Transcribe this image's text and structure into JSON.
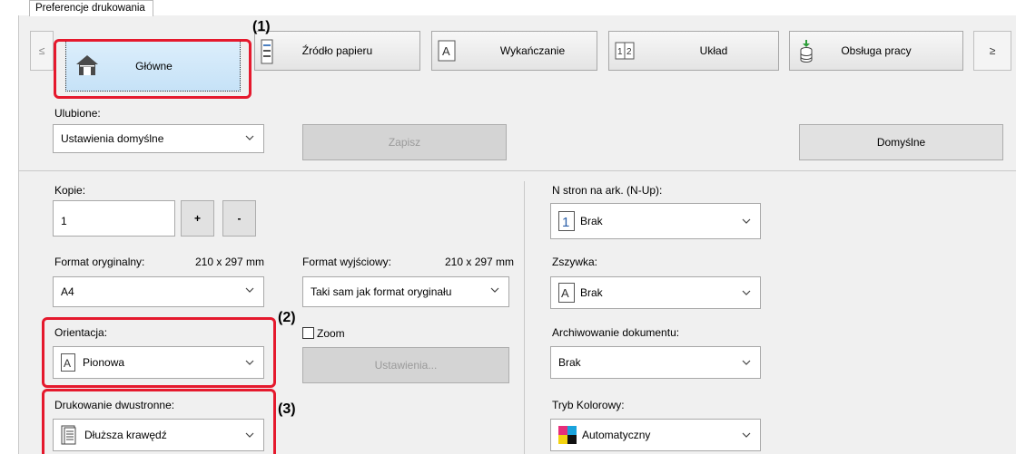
{
  "window": {
    "tab_title": "Preferencje drukowania"
  },
  "toolbar": {
    "prev_arrow": "≤",
    "next_arrow": "≥",
    "tabs": [
      {
        "label": "Główne",
        "icon": "home-icon"
      },
      {
        "label": "Źródło papieru",
        "icon": "paper-tray-icon"
      },
      {
        "label": "Wykańczanie",
        "icon": "finishing-icon"
      },
      {
        "label": "Układ",
        "icon": "layout-icon"
      },
      {
        "label": "Obsługa pracy",
        "icon": "job-handling-icon"
      }
    ]
  },
  "favorites": {
    "label": "Ulubione:",
    "value": "Ustawienia domyślne",
    "save_label": "Zapisz",
    "defaults_label": "Domyślne"
  },
  "copies": {
    "label": "Kopie:",
    "value": "1",
    "plus": "+",
    "minus": "-"
  },
  "original_size": {
    "label": "Format oryginalny:",
    "size": "210 x 297 mm",
    "value": "A4"
  },
  "output_size": {
    "label": "Format wyjściowy:",
    "size": "210 x 297 mm",
    "value": "Taki sam jak format oryginału"
  },
  "orientation": {
    "label": "Orientacja:",
    "value": "Pionowa"
  },
  "zoom": {
    "label": "Zoom",
    "checked": false,
    "settings_label": "Ustawienia..."
  },
  "duplex": {
    "label": "Drukowanie dwustronne:",
    "value": "Dłuższa krawędź"
  },
  "nup": {
    "label": "N stron na ark. (N-Up):",
    "value": "Brak"
  },
  "staple": {
    "label": "Zszywka:",
    "value": "Brak"
  },
  "archive": {
    "label": "Archiwowanie dokumentu:",
    "value": "Brak"
  },
  "color_mode": {
    "label": "Tryb Kolorowy:",
    "value": "Automatyczny"
  },
  "callouts": {
    "c1": "(1)",
    "c2": "(2)",
    "c3": "(3)"
  },
  "colors": {
    "highlight": "#e5192d",
    "selected_tab": "#c6e2f7"
  }
}
